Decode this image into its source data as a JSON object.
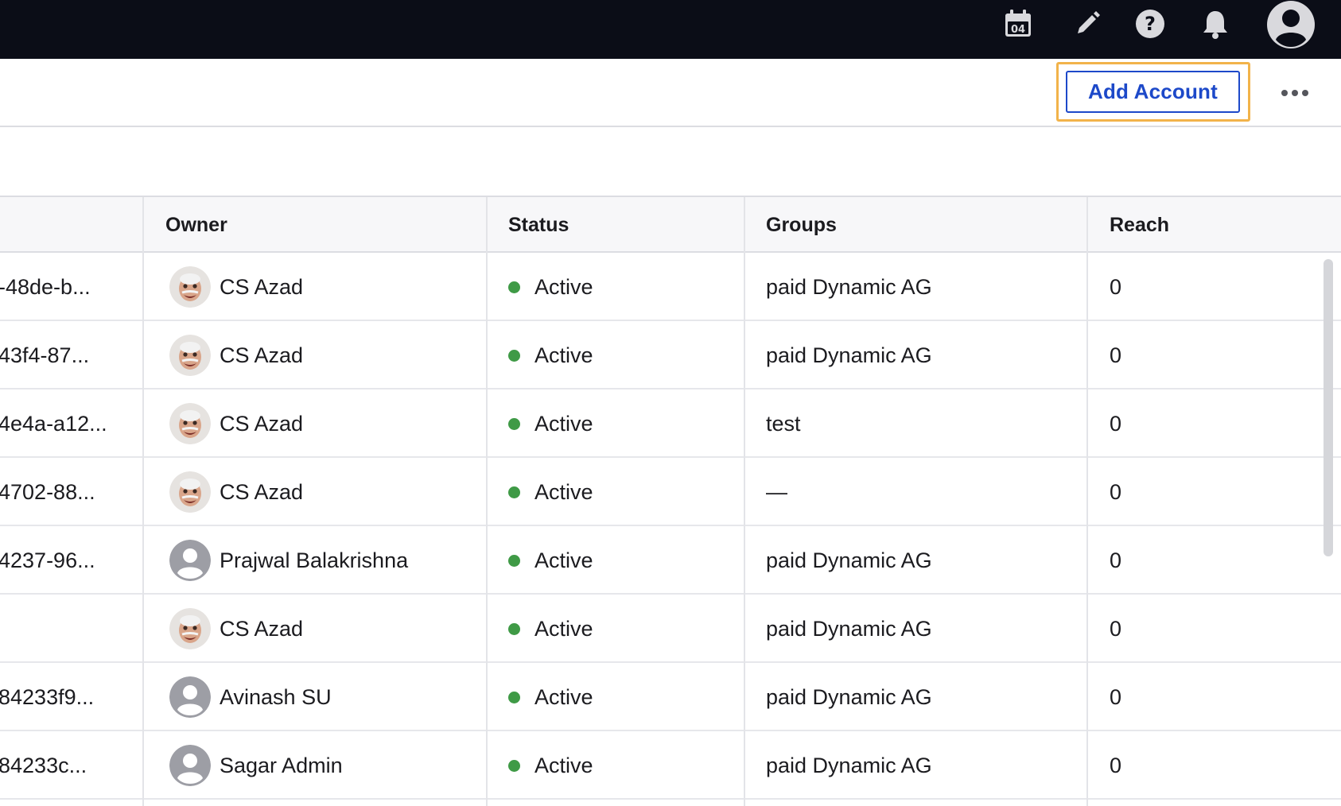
{
  "topbar": {
    "calendar_day": "04",
    "icons": [
      "calendar-icon",
      "pencil-icon",
      "help-icon",
      "bell-icon",
      "user-avatar-icon"
    ]
  },
  "actions": {
    "add_account_label": "Add Account",
    "more_icon": "more-horizontal-icon"
  },
  "toolbar": {
    "icons": [
      "search-icon",
      "filter-icon",
      "refresh-icon"
    ]
  },
  "table": {
    "columns": [
      "Owner",
      "Status",
      "Groups",
      "Reach"
    ],
    "rows": [
      {
        "id": "-48de-b...",
        "owner": "CS Azad",
        "avatar": "photo",
        "status": "Active",
        "groups": "paid Dynamic AG",
        "reach": "0"
      },
      {
        "id": "43f4-87...",
        "owner": "CS Azad",
        "avatar": "photo",
        "status": "Active",
        "groups": "paid Dynamic AG",
        "reach": "0"
      },
      {
        "id": "4e4a-a12...",
        "owner": "CS Azad",
        "avatar": "photo",
        "status": "Active",
        "groups": "test",
        "reach": "0"
      },
      {
        "id": "4702-88...",
        "owner": "CS Azad",
        "avatar": "photo",
        "status": "Active",
        "groups": "—",
        "reach": "0"
      },
      {
        "id": "4237-96...",
        "owner": "Prajwal Balakrishna",
        "avatar": "placeholder",
        "status": "Active",
        "groups": "paid Dynamic AG",
        "reach": "0"
      },
      {
        "id": "",
        "owner": "CS Azad",
        "avatar": "photo",
        "status": "Active",
        "groups": "paid Dynamic AG",
        "reach": "0"
      },
      {
        "id": "84233f9...",
        "owner": "Avinash SU",
        "avatar": "placeholder",
        "status": "Active",
        "groups": "paid Dynamic AG",
        "reach": "0"
      },
      {
        "id": "84233c...",
        "owner": "Sagar Admin",
        "avatar": "placeholder",
        "status": "Active",
        "groups": "paid Dynamic AG",
        "reach": "0"
      }
    ]
  },
  "colors": {
    "topbar_bg": "#0b0d17",
    "primary": "#1d49c9",
    "focus_ring": "#f2b34a",
    "status_active": "#3f9a46"
  }
}
